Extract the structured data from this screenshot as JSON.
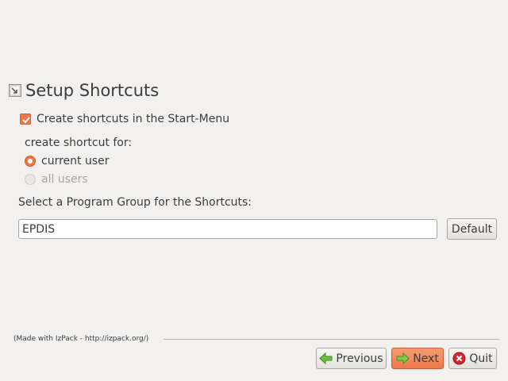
{
  "panel": {
    "title": "Setup Shortcuts",
    "title_icon": "shortcut-arrow-icon"
  },
  "create_shortcuts": {
    "label": "Create shortcuts in the Start-Menu",
    "checked": true
  },
  "shortcut_for": {
    "label": "create shortcut for:",
    "options": [
      {
        "label": "current user",
        "selected": true,
        "enabled": true
      },
      {
        "label": "all users",
        "selected": false,
        "enabled": false
      }
    ]
  },
  "program_group": {
    "label": "Select a Program Group for the Shortcuts:",
    "value": "EPDIS",
    "default_button": "Default"
  },
  "footer": {
    "credit": "(Made with IzPack - http://izpack.org/)"
  },
  "nav": {
    "previous": "Previous",
    "next": "Next",
    "quit": "Quit",
    "previous_icon": "green-left-arrow-icon",
    "next_icon": "green-right-arrow-icon",
    "quit_icon": "red-x-icon"
  },
  "colors": {
    "accent": "#f07746",
    "background": "#f2f1f0"
  }
}
